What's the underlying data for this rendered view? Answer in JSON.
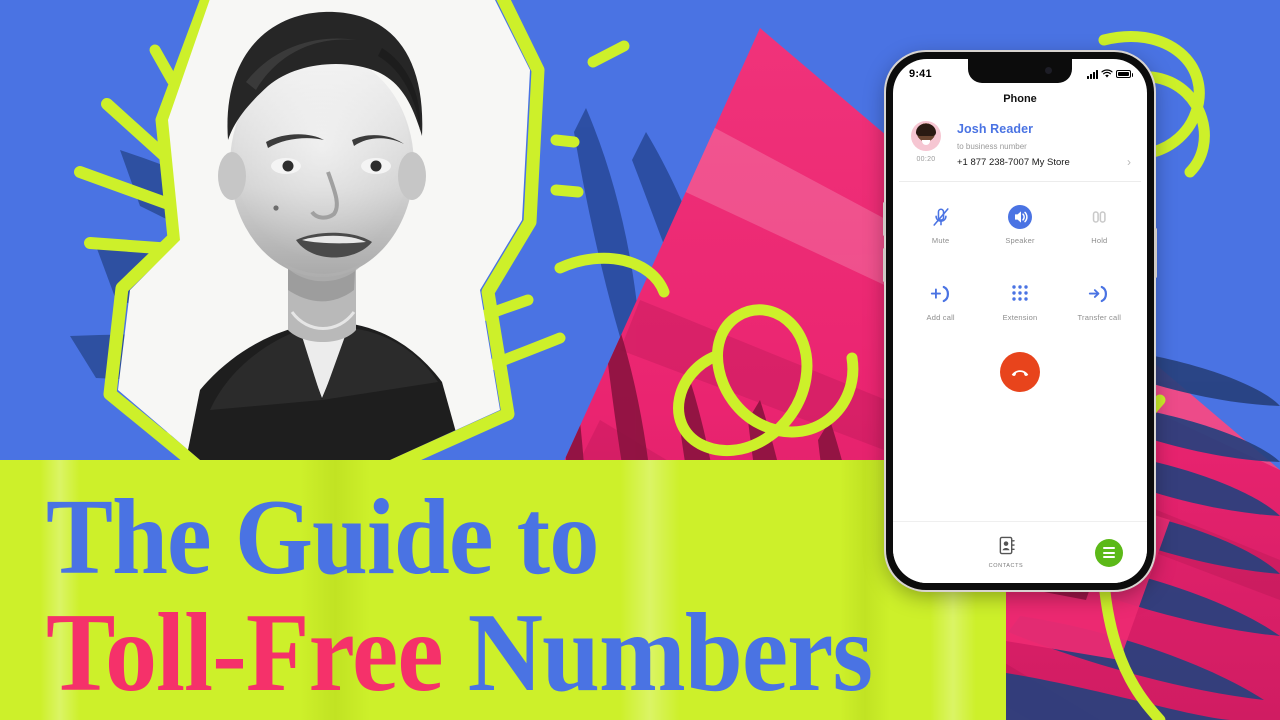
{
  "video": {
    "headline_line1": "The Guide to",
    "headline_line2_highlight": "Toll-Free",
    "headline_line2_rest": " Numbers",
    "colors": {
      "background_blue": "#4a73e3",
      "banner_lime": "#cdf02a",
      "accent_pink": "#ed2a72",
      "title_blue": "#4a73e3",
      "title_pink": "#f5316a",
      "end_call_red": "#e8441c",
      "fab_green": "#5cb918"
    }
  },
  "phone": {
    "status_bar": {
      "time": "9:41",
      "signal_icon": "cellular-bars-icon",
      "wifi_icon": "wifi-icon",
      "battery_icon": "battery-full-icon"
    },
    "screen_title": "Phone",
    "call": {
      "contact_name": "Josh Reader",
      "subtitle": "to business number",
      "number": "+1 877 238-7007 My Store",
      "duration": "00:20",
      "chevron": "›"
    },
    "controls_row1": [
      {
        "label": "Mute",
        "icon": "mute-icon",
        "active": false
      },
      {
        "label": "Speaker",
        "icon": "speaker-icon",
        "active": true
      },
      {
        "label": "Hold",
        "icon": "hold-icon",
        "active": false
      }
    ],
    "controls_row2": [
      {
        "label": "Add call",
        "icon": "add-call-icon",
        "active": false
      },
      {
        "label": "Extension",
        "icon": "dialpad-icon",
        "active": false
      },
      {
        "label": "Transfer call",
        "icon": "transfer-call-icon",
        "active": false
      }
    ],
    "end_call": {
      "label": "",
      "icon": "end-call-icon"
    },
    "tabbar": {
      "contacts_label": "CONTACTS",
      "contacts_icon": "contacts-book-icon",
      "menu_icon": "hamburger-menu-icon"
    }
  }
}
